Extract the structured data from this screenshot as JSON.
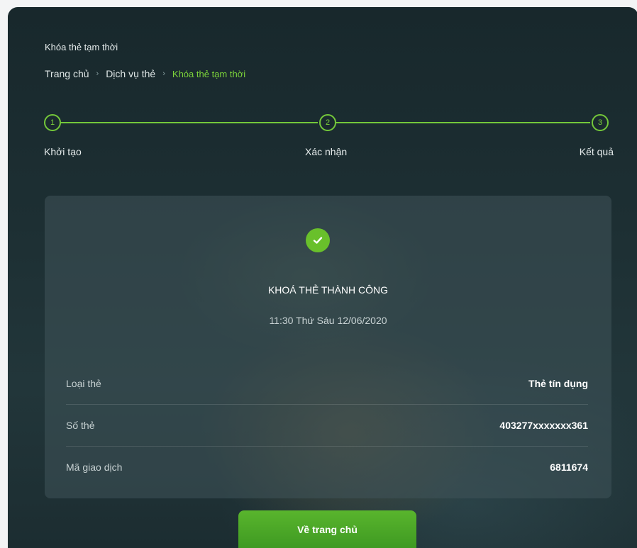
{
  "page": {
    "title": "Khóa thẻ tạm thời"
  },
  "breadcrumb": {
    "items": [
      "Trang chủ",
      "Dịch vụ thẻ",
      "Khóa thẻ tạm thời"
    ],
    "separator": "›"
  },
  "stepper": {
    "steps": [
      {
        "number": "1",
        "label": "Khởi tạo"
      },
      {
        "number": "2",
        "label": "Xác nhận"
      },
      {
        "number": "3",
        "label": "Kết quả"
      }
    ],
    "accent_color": "#74c83a"
  },
  "result": {
    "icon": "check-icon",
    "title": "KHOÁ THẺ THÀNH CÔNG",
    "time": "11:30 Thứ Sáu 12/06/2020"
  },
  "details": [
    {
      "label": "Loại thẻ",
      "value": "Thẻ tín dụng"
    },
    {
      "label": "Số thẻ",
      "value": "403277xxxxxxx361"
    },
    {
      "label": "Mã giao dịch",
      "value": "6811674"
    }
  ],
  "home_button": {
    "label": "Về trang chủ"
  },
  "colors": {
    "brand_green": "#69c02b",
    "panel_bg": "#1d2f33"
  }
}
